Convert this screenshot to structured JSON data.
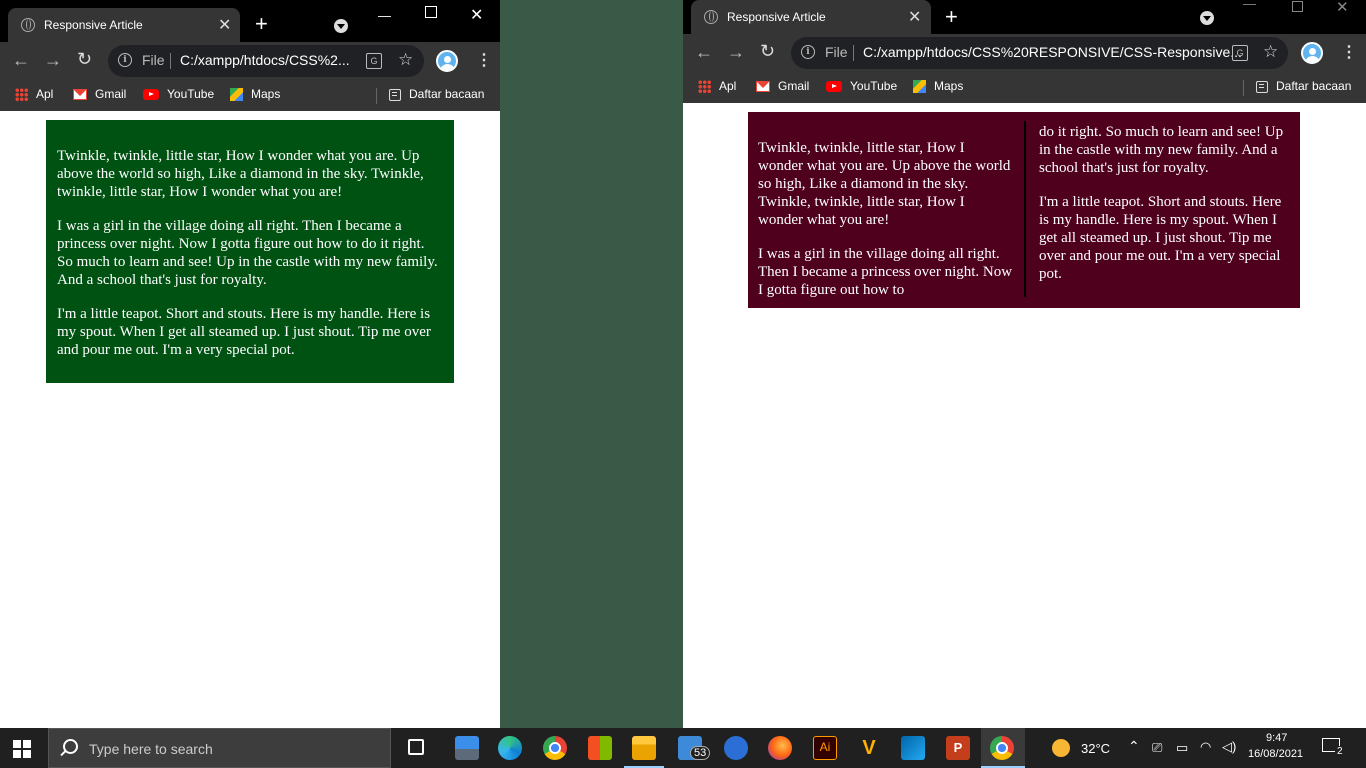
{
  "left_window": {
    "tab_title": "Responsive Article",
    "url": "C:/xampp/htdocs/CSS%2...",
    "url_scheme_label": "File",
    "article_bg": "#005213",
    "paragraphs": [
      "Twinkle, twinkle, little star, How I wonder what you are. Up above the world so high, Like a diamond in the sky. Twinkle, twinkle, little star, How I wonder what you are!",
      "I was a girl in the village doing all right. Then I became a princess over night. Now I gotta figure out how to do it right. So much to learn and see! Up in the castle with my new family. And a school that's just for royalty.",
      "I'm a little teapot. Short and stouts. Here is my handle. Here is my spout. When I get all steamed up. I just shout. Tip me over and pour me out. I'm a very special pot."
    ]
  },
  "right_window": {
    "tab_title": "Responsive Article",
    "url": "C:/xampp/htdocs/CSS%20RESPONSIVE/CSS-Responsive...",
    "url_scheme_label": "File",
    "article_bg": "#4f001c",
    "col1": {
      "p1": "Twinkle, twinkle, little star, How I wonder what you are. Up above the world so high, Like a diamond in the sky. Twinkle, twinkle, little star, How I wonder what you are!",
      "p2": "I was a girl in the village doing all right. Then I became a princess over night. Now I gotta figure out how to"
    },
    "col2": {
      "p1": "do it right. So much to learn and see! Up in the castle with my new family. And a school that's just for royalty.",
      "p2": "I'm a little teapot. Short and stouts. Here is my handle. Here is my spout. When I get all steamed up. I just shout. Tip me over and pour me out. I'm a very special pot."
    }
  },
  "bookmarks": {
    "apps": "Apl",
    "gmail": "Gmail",
    "youtube": "YouTube",
    "maps": "Maps",
    "reading_list": "Daftar bacaan"
  },
  "taskbar": {
    "search_placeholder": "Type here to search",
    "mail_badge": "53",
    "weather": "32°C",
    "time": "9:47",
    "date": "16/08/2021",
    "notifications": "2"
  },
  "colors": {
    "desktop": "#3a5a47",
    "tab_active": "#353535",
    "taskbar": "#202020"
  },
  "icons": [
    "windows-start-icon",
    "search-icon",
    "task-view-icon",
    "edge-icon",
    "chrome-icon",
    "store-icon",
    "file-explorer-icon",
    "mail-icon",
    "illustrator-icon",
    "visual-studio-icon",
    "vscode-icon",
    "powerpoint-icon",
    "weather-icon",
    "wifi-icon",
    "volume-icon",
    "battery-icon",
    "notification-icon"
  ]
}
